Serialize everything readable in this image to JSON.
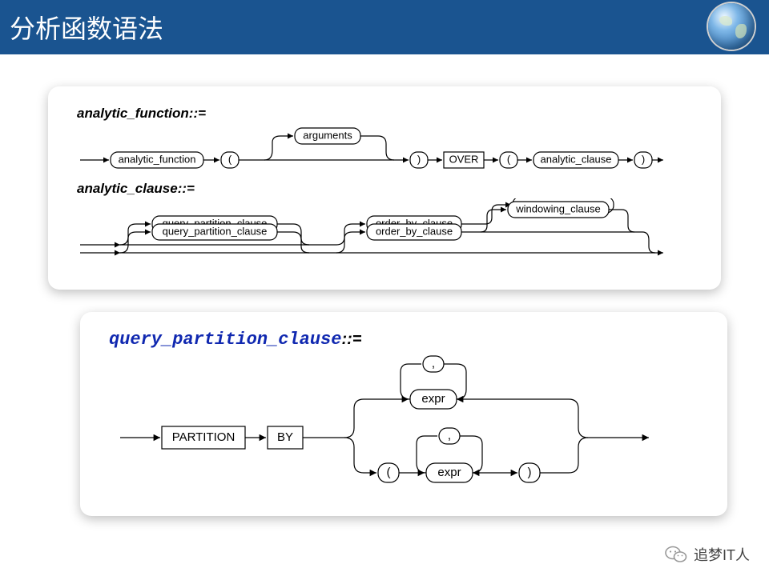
{
  "header": {
    "title": "分析函数语法"
  },
  "diagram1": {
    "rule_name": "analytic_function::=",
    "nodes": {
      "analytic_function": "analytic_function",
      "lparen1": "(",
      "arguments": "arguments",
      "rparen1": ")",
      "over": "OVER",
      "lparen2": "(",
      "analytic_clause": "analytic_clause",
      "rparen2": ")"
    }
  },
  "diagram2": {
    "rule_name": "analytic_clause::=",
    "nodes": {
      "query_partition_clause": "query_partition_clause",
      "order_by_clause": "order_by_clause",
      "windowing_clause": "windowing_clause"
    }
  },
  "diagram3": {
    "rule_name_prefix": "query_partition_clause",
    "rule_name_suffix": "::=",
    "nodes": {
      "partition": "PARTITION",
      "by": "BY",
      "comma1": ",",
      "expr1": "expr",
      "lparen": "(",
      "comma2": ",",
      "expr2": "expr",
      "rparen": ")"
    }
  },
  "footer": {
    "brand": "追梦IT人"
  }
}
